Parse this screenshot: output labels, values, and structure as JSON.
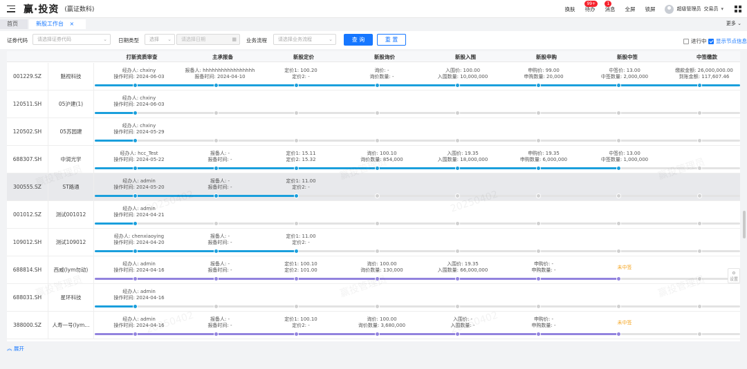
{
  "app": {
    "title": "赢·投资",
    "subtitle": "(赢证数科)"
  },
  "top_nav": {
    "skin": "换肤",
    "todo": "待办",
    "todo_badge": "99+",
    "message": "消息",
    "message_badge": "1",
    "fullscreen": "全屏",
    "lock": "锁屏",
    "user": "超级管理员",
    "role": "交易员"
  },
  "tabs": [
    {
      "label": "首页"
    },
    {
      "label": "新股工作台",
      "close": "×"
    }
  ],
  "more_label": "更多",
  "filters": {
    "code_label": "证券代码",
    "code_placeholder": "请选择证券代码",
    "date_type_label": "日期类型",
    "date_type_placeholder": "选择",
    "date_placeholder": "请选择日期",
    "flow_label": "业务流程",
    "flow_placeholder": "请选择业务流程",
    "search_button": "查 询",
    "reset_button": "重 置",
    "in_progress_label": "进行中",
    "show_node_info_label": "显示节点信息"
  },
  "columns": [
    "打新资质审查",
    "主承报备",
    "新股定价",
    "新股询价",
    "新股入围",
    "新股申购",
    "新股中签",
    "中签缴款"
  ],
  "expand_label": "展开",
  "settings_label": "设置",
  "colors": {
    "blue": "#1a9fdc",
    "purple": "#9283de",
    "primary": "#1677ff",
    "warning": "#f5a623"
  },
  "rows": [
    {
      "code": "001229.SZ",
      "name": "魅视科技",
      "progress_nodes": 8,
      "color": "blue",
      "highlight": false,
      "cells": [
        [
          "经办人: chxiny",
          "操作时间: 2024-06-03"
        ],
        [
          "报备人: hhhhhhhhhhhhhhhhh",
          "报备时间: 2024-04-10"
        ],
        [
          "定价1: 100.20",
          "定价2: -"
        ],
        [
          "询价: -",
          "询价数量: -"
        ],
        [
          "入围价: 100.00",
          "入围数量: 10,000,000"
        ],
        [
          "申购价: 99.00",
          "申购数量: 20,000"
        ],
        [
          "中签价: 13.00",
          "中签数量: 2,000,000"
        ],
        [
          "缴款金额: 26,000,000.00",
          "到账金额: 117,607.46"
        ]
      ]
    },
    {
      "code": "120511.SH",
      "name": "05沪建(1)",
      "progress_nodes": 1,
      "color": "blue",
      "highlight": false,
      "cells": [
        [
          "经办人: chxiny",
          "操作时间: 2024-06-03"
        ]
      ]
    },
    {
      "code": "120502.SH",
      "name": "05苏园建",
      "progress_nodes": 1,
      "color": "blue",
      "highlight": false,
      "cells": [
        [
          "经办人: chxiny",
          "操作时间: 2024-05-29"
        ]
      ]
    },
    {
      "code": "688307.SH",
      "name": "中润光学",
      "progress_nodes": 7,
      "color": "blue",
      "highlight": false,
      "cells": [
        [
          "经办人: hcc_Test",
          "操作时间: 2024-05-22"
        ],
        [
          "报备人: -",
          "报备时间: -"
        ],
        [
          "定价1: 15.11",
          "定价2: 15.32"
        ],
        [
          "询价: 100.10",
          "询价数量: 854,000"
        ],
        [
          "入围价: 19.35",
          "入围数量: 18,000,000"
        ],
        [
          "申购价: 19.35",
          "申购数量: 6,000,000"
        ],
        [
          "中签价: 13.00",
          "中签数量: 1,000,000"
        ]
      ]
    },
    {
      "code": "300555.SZ",
      "name": "ST路通",
      "progress_nodes": 3,
      "color": "blue",
      "highlight": true,
      "cells": [
        [
          "经办人: admin",
          "操作时间: 2024-05-20"
        ],
        [
          "报备人: -",
          "报备时间: -"
        ],
        [
          "定价1: 11.00",
          "定价2: -"
        ]
      ]
    },
    {
      "code": "001012.SZ",
      "name": "测试001012",
      "progress_nodes": 1,
      "color": "blue",
      "highlight": false,
      "cells": [
        [
          "经办人: admin",
          "操作时间: 2024-04-21"
        ]
      ]
    },
    {
      "code": "109012.SH",
      "name": "测试109012",
      "progress_nodes": 3,
      "color": "blue",
      "highlight": false,
      "cells": [
        [
          "经办人: chenxiaoying",
          "操作时间: 2024-04-20"
        ],
        [
          "报备人: -",
          "报备时间: -"
        ],
        [
          "定价1: 11.00",
          "定价2: -"
        ]
      ]
    },
    {
      "code": "688814.SH",
      "name": "西威(lym勿动)",
      "progress_nodes": 7,
      "color": "purple",
      "highlight": false,
      "status": "未中签",
      "cells": [
        [
          "经办人: admin",
          "操作时间: 2024-04-16"
        ],
        [
          "报备人: -",
          "报备时间: -"
        ],
        [
          "定价1: 100.10",
          "定价2: 101.00"
        ],
        [
          "询价: 100.00",
          "询价数量: 130,000"
        ],
        [
          "入围价: 19.35",
          "入围数量: 66,000,000"
        ],
        [
          "申购价: -",
          "申购数量: -"
        ]
      ]
    },
    {
      "code": "688031.SH",
      "name": "星环科技",
      "progress_nodes": 1,
      "color": "blue",
      "highlight": false,
      "cells": [
        [
          "经办人: admin",
          "操作时间: 2024-04-16"
        ]
      ]
    },
    {
      "code": "388000.SZ",
      "name": "人寿一号(lym...",
      "progress_nodes": 7,
      "color": "purple",
      "highlight": false,
      "status": "未中签",
      "cells": [
        [
          "经办人: admin",
          "操作时间: 2024-04-16"
        ],
        [
          "报备人: -",
          "报备时间: -"
        ],
        [
          "定价1: 100.10",
          "定价2: -"
        ],
        [
          "询价: 100.00",
          "询价数量: 3,680,000"
        ],
        [
          "入围价: -",
          "入围数量: -"
        ],
        [
          "申购价: -",
          "申购数量: -"
        ]
      ]
    }
  ]
}
